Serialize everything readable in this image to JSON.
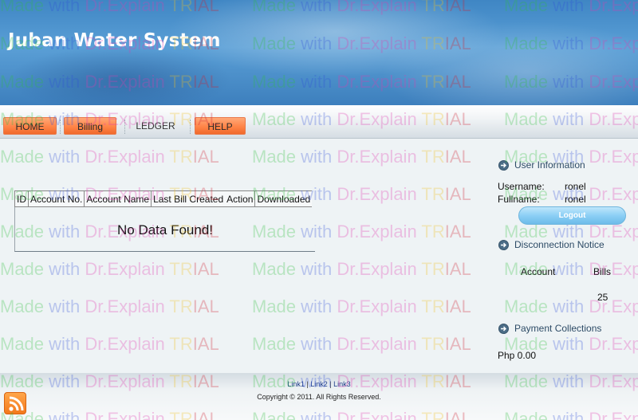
{
  "header": {
    "title": "Juban Water System"
  },
  "nav": {
    "items": [
      {
        "label": "HOME",
        "style": "orange"
      },
      {
        "label": "Billing",
        "style": "orange"
      },
      {
        "label": "LEDGER",
        "style": "plain"
      },
      {
        "label": "HELP",
        "style": "orange"
      }
    ]
  },
  "table": {
    "columns": [
      "ID",
      "Account No.",
      "Account Name",
      "Last Bill Created",
      "Action",
      "Downloaded"
    ],
    "empty_message": "No Data Found!"
  },
  "sidebar": {
    "user_info": {
      "heading": "User Information",
      "username_label": "Username:",
      "username_value": "ronel",
      "fullname_label": "Fullname:",
      "fullname_value": "ronel",
      "logout_label": "Logout"
    },
    "disconnection": {
      "heading": "Disconnection Notice",
      "account_label": "Account",
      "bills_label": "Bills",
      "bills_value": "25"
    },
    "payments": {
      "heading": "Payment Collections",
      "amount": "Php 0.00"
    }
  },
  "footer": {
    "links": [
      "Link1",
      "Link2",
      "Link3"
    ],
    "separator": "|",
    "copyright": "Copyright © 2011. All Rights Reserved."
  },
  "watermark": {
    "made": "Made",
    "with": " with ",
    "dr": "Dr.Explain",
    "tr": " TR",
    "ial": "IAL"
  },
  "colors": {
    "nav_orange": "#ff8448",
    "header_blue": "#3f86c4",
    "logout_blue": "#8ccff5"
  }
}
